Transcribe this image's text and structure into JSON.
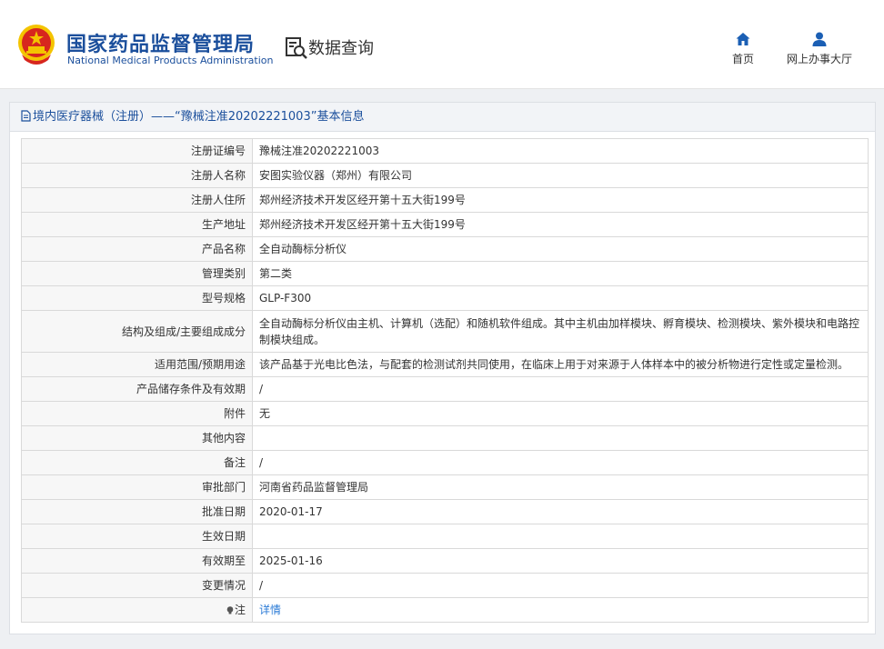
{
  "header": {
    "org_name_cn": "国家药品监督管理局",
    "org_name_en": "National Medical Products Administration",
    "page_title": "数据查询",
    "nav": [
      {
        "label": "首页",
        "icon": "home-icon"
      },
      {
        "label": "网上办事大厅",
        "icon": "user-icon"
      }
    ]
  },
  "panel": {
    "title": "境内医疗器械（注册）——“豫械注准20202221003”基本信息",
    "rows": [
      {
        "label": "注册证编号",
        "value": "豫械注准20202221003"
      },
      {
        "label": "注册人名称",
        "value": "安图实验仪器（郑州）有限公司"
      },
      {
        "label": "注册人住所",
        "value": "郑州经济技术开发区经开第十五大街199号"
      },
      {
        "label": "生产地址",
        "value": "郑州经济技术开发区经开第十五大街199号"
      },
      {
        "label": "产品名称",
        "value": "全自动酶标分析仪"
      },
      {
        "label": "管理类别",
        "value": "第二类"
      },
      {
        "label": "型号规格",
        "value": "GLP-F300"
      },
      {
        "label": "结构及组成/主要组成成分",
        "value": "全自动酶标分析仪由主机、计算机（选配）和随机软件组成。其中主机由加样模块、孵育模块、检测模块、紫外模块和电路控制模块组成。"
      },
      {
        "label": "适用范围/预期用途",
        "value": "该产品基于光电比色法，与配套的检测试剂共同使用，在临床上用于对来源于人体样本中的被分析物进行定性或定量检测。"
      },
      {
        "label": "产品储存条件及有效期",
        "value": "/"
      },
      {
        "label": "附件",
        "value": "无"
      },
      {
        "label": "其他内容",
        "value": ""
      },
      {
        "label": "备注",
        "value": "/"
      },
      {
        "label": "审批部门",
        "value": "河南省药品监督管理局"
      },
      {
        "label": "批准日期",
        "value": "2020-01-17"
      },
      {
        "label": "生效日期",
        "value": ""
      },
      {
        "label": "有效期至",
        "value": "2025-01-16"
      },
      {
        "label": "变更情况",
        "value": "/"
      }
    ],
    "note": {
      "label": "注",
      "link": "详情",
      "icon": "bulb-icon"
    }
  },
  "colors": {
    "brand": "#1b4f9c",
    "link": "#2b7bd6",
    "emblem_red": "#d7261e",
    "emblem_gold": "#f4c400"
  }
}
